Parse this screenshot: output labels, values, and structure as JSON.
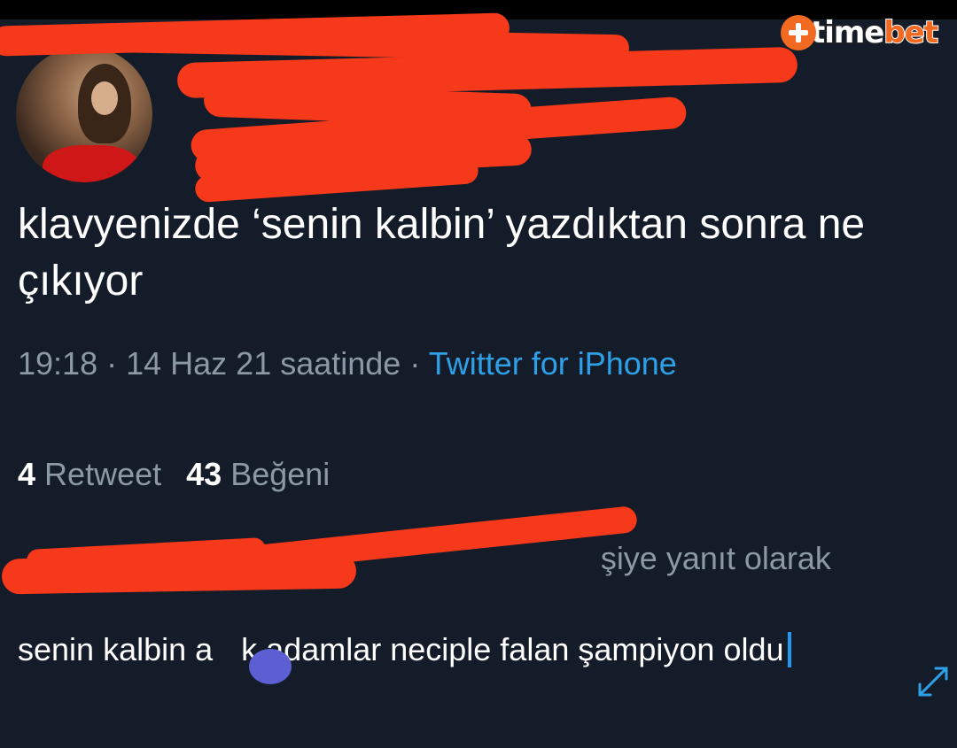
{
  "watermark": {
    "part1": "time",
    "part2": "bet"
  },
  "tweet": {
    "text": "klavyenizde ‘senin kalbin’ yazdıktan sonra ne çıkıyor",
    "time": "19:18",
    "date": "14 Haz 21 saatinde",
    "source": "Twitter for iPhone",
    "retweet_count": "4",
    "retweet_label": "Retweet",
    "like_count": "43",
    "like_label": "Beğeni"
  },
  "reply": {
    "replying_to_suffix": "şiye yanıt olarak",
    "text_part1": "senin kalbin a",
    "text_part2": "k adamlar neciple falan şampiyon oldu"
  },
  "colors": {
    "background": "#151c29",
    "link": "#2ea0e8",
    "redaction": "#f5391a",
    "caret": "#1d9bf0"
  },
  "icons": {
    "expand": "expand-arrows-icon",
    "avatar": "profile-avatar"
  }
}
